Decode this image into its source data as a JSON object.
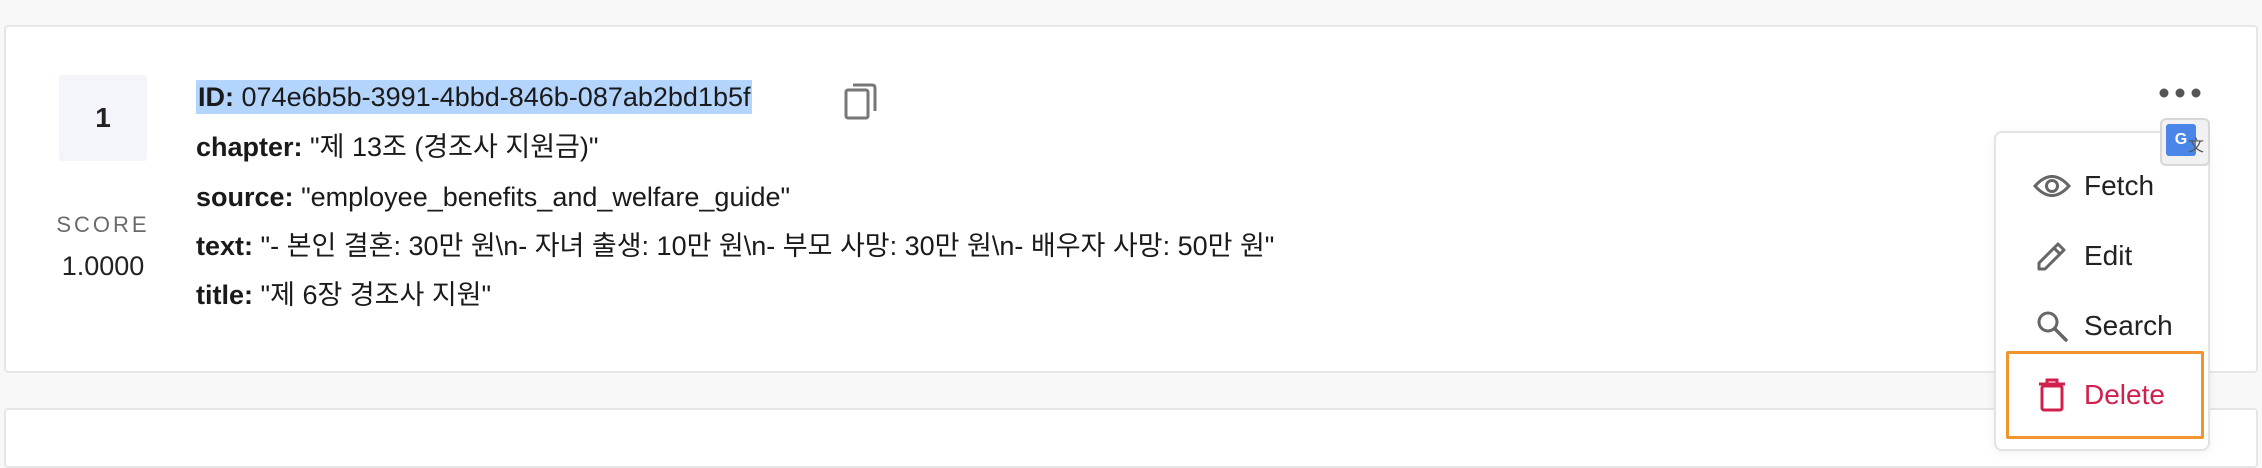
{
  "result": {
    "rank": "1",
    "score_label": "SCORE",
    "score_value": "1.0000",
    "fields": {
      "id": {
        "key": "ID:",
        "value": "074e6b5b-3991-4bbd-846b-087ab2bd1b5f"
      },
      "chapter": {
        "key": "chapter:",
        "value": "\"제 13조 (경조사 지원금)\""
      },
      "source": {
        "key": "source:",
        "value": "\"employee_benefits_and_welfare_guide\""
      },
      "text": {
        "key": "text:",
        "value": "\"- 본인 결혼: 30만 원\\n- 자녀 출생: 10만 원\\n- 부모 사망: 30만 원\\n- 배우자 사망: 50만 원\""
      },
      "title": {
        "key": "title:",
        "value": "\"제 6장 경조사 지원\""
      }
    }
  },
  "menu": {
    "items": [
      {
        "label": "Fetch",
        "icon": "eye-icon"
      },
      {
        "label": "Edit",
        "icon": "pencil-icon"
      },
      {
        "label": "Search",
        "icon": "search-icon"
      },
      {
        "label": "Delete",
        "icon": "trash-icon"
      }
    ]
  },
  "colors": {
    "delete": "#d0204e",
    "highlight": "#b3d4fc",
    "focus_outline": "#f0952e"
  }
}
